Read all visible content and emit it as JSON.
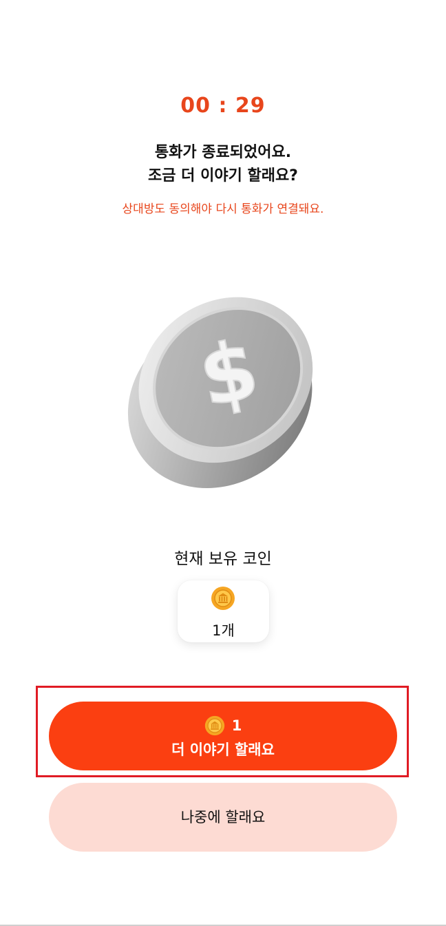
{
  "timer": {
    "text": "00 : 29"
  },
  "message": {
    "title_line1": "통화가 종료되었어요.",
    "title_line2": "조금 더 이야기 할래요?",
    "subtitle": "상대방도 동의해야 다시 통화가 연결돼요."
  },
  "illustration": {
    "icon": "dollar-coin-icon"
  },
  "balance": {
    "label": "현재 보유 코인",
    "icon": "gold-coin-icon",
    "count": "1개"
  },
  "actions": {
    "continue": {
      "icon": "gold-coin-icon",
      "cost": "1",
      "label": "더 이야기 할래요"
    },
    "later": {
      "label": "나중에 할래요"
    }
  },
  "colors": {
    "accent": "#e8461c",
    "primary_button": "#fb3f11",
    "secondary_button": "#fddbd3",
    "highlight": "#e01b24",
    "coin_gold": "#f6a623"
  }
}
